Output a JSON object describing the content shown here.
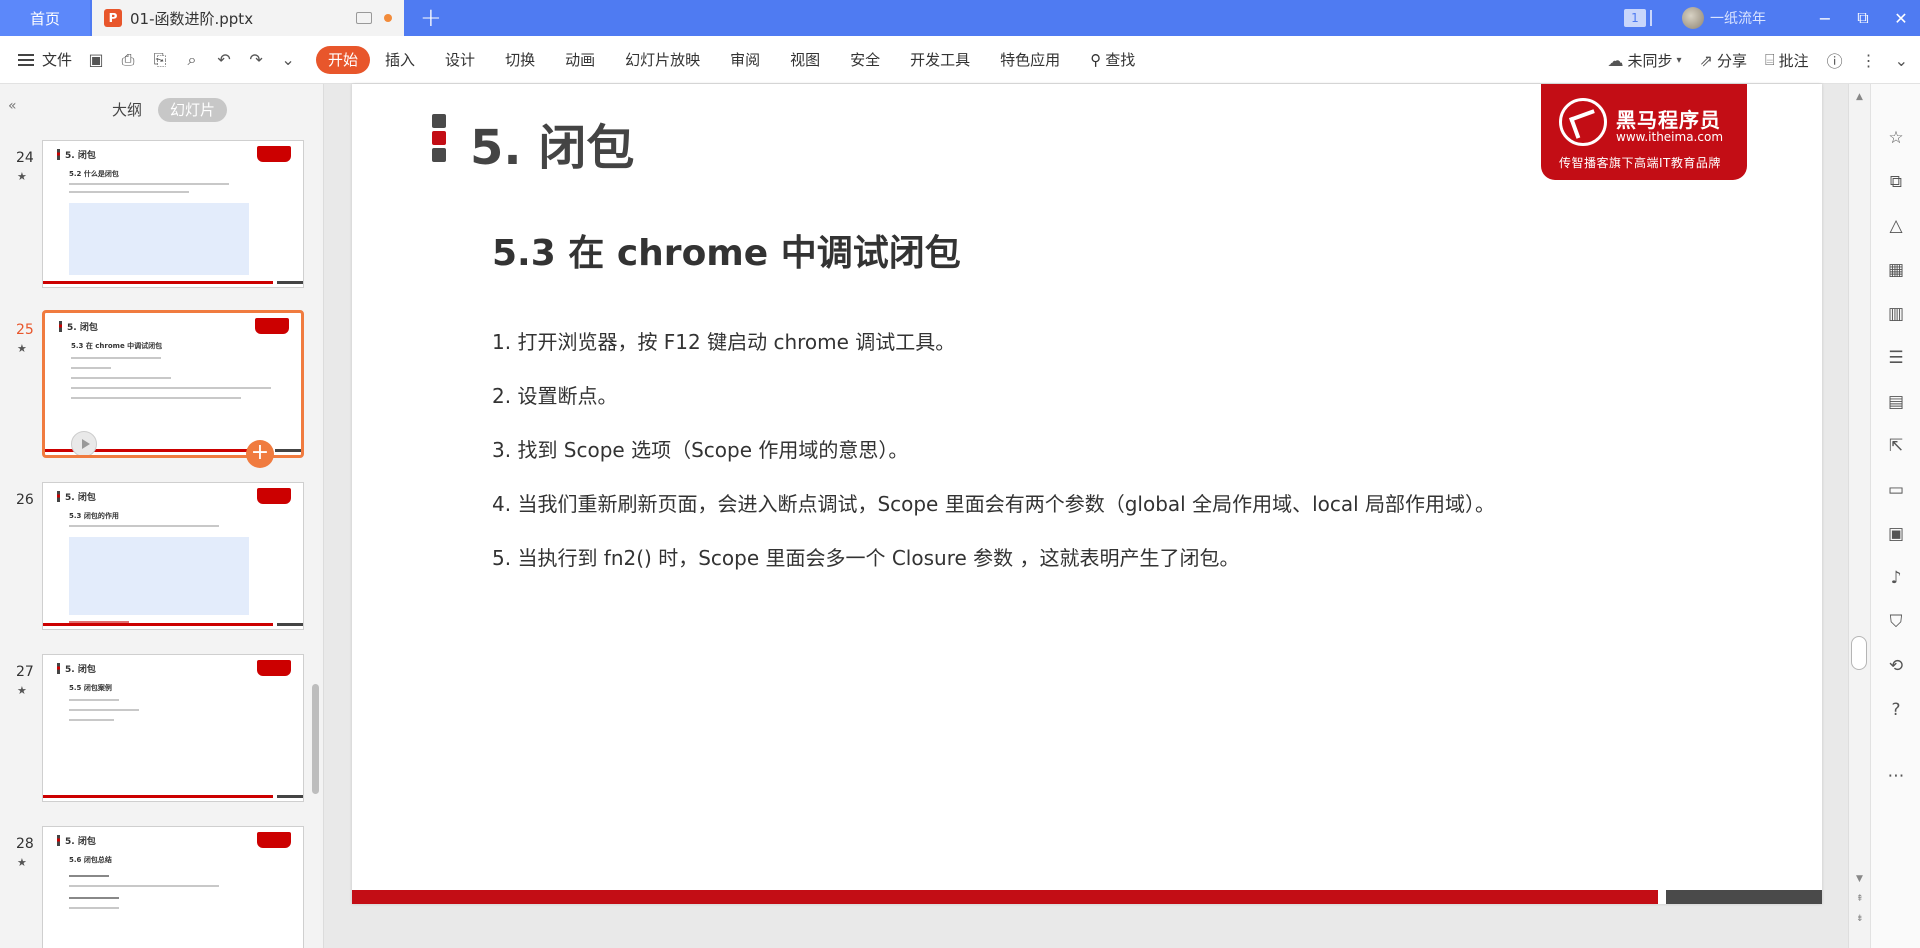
{
  "titlebar": {
    "home_tab": "首页",
    "doc_icon": "P",
    "doc_name": "01-函数进阶.pptx",
    "new_tab": "+",
    "count_badge": "1",
    "user_name": "一纸流年",
    "minimize": "−",
    "restore": "⧉",
    "close": "✕"
  },
  "ribbon": {
    "file_label": "文件",
    "tabs": [
      "开始",
      "插入",
      "设计",
      "切换",
      "动画",
      "幻灯片放映",
      "审阅",
      "视图",
      "安全",
      "开发工具",
      "特色应用"
    ],
    "search_label": "查找",
    "sync_label": "未同步",
    "share_label": "分享",
    "comment_label": "批注"
  },
  "leftpanel": {
    "tab_outline": "大纲",
    "tab_slides": "幻灯片",
    "thumbs": [
      {
        "num": "24",
        "title": "5. 闭包",
        "sub": "5.2 什么是闭包"
      },
      {
        "num": "25",
        "title": "5. 闭包",
        "sub": "5.3 在 chrome 中调试闭包"
      },
      {
        "num": "26",
        "title": "5. 闭包",
        "sub": "5.3 闭包的作用"
      },
      {
        "num": "27",
        "title": "5. 闭包",
        "sub": "5.5 闭包案例"
      },
      {
        "num": "28",
        "title": "5. 闭包",
        "sub": "5.6 闭包总结"
      }
    ],
    "star": "★"
  },
  "slide": {
    "title": "5. 闭包",
    "logo_main": "黑马程序员",
    "logo_url": "www.itheima.com",
    "logo_tag": "传智播客旗下高端IT教育品牌",
    "subtitle": "5.3 在 chrome 中调试闭包",
    "items": [
      "1. 打开浏览器，按 F12 键启动 chrome 调试工具。",
      "2. 设置断点。",
      "3. 找到 Scope 选项（Scope 作用域的意思）。",
      "4. 当我们重新刷新页面，会进入断点调试，Scope 里面会有两个参数（global 全局作用域、local 局部作用域）。",
      "5. 当执行到 fn2() 时，Scope 里面会多一个 Closure 参数 ，这就表明产生了闭包。"
    ]
  },
  "colors": {
    "titlebar": "#4f7bf2",
    "accent": "#e8562b",
    "brand_red": "#c30d15"
  }
}
